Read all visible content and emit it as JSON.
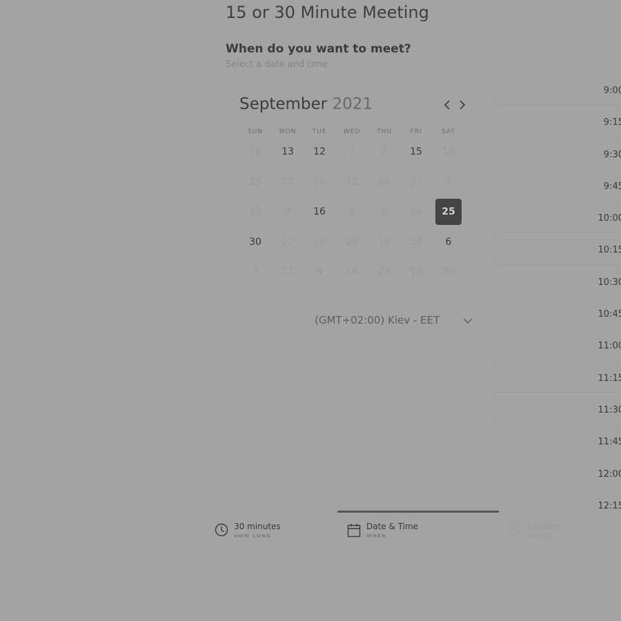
{
  "header": {
    "title": "15 or 30 Minute Meeting",
    "question": "When do you want to meet?",
    "subtitle": "Select a date and time"
  },
  "calendar": {
    "month": "September",
    "year": "2021",
    "weekdays": [
      "SUN",
      "MON",
      "TUE",
      "WED",
      "THU",
      "FRI",
      "SAT"
    ],
    "weeks": [
      [
        {
          "d": "28",
          "s": "disabled"
        },
        {
          "d": "13",
          "s": "available"
        },
        {
          "d": "12",
          "s": "available"
        },
        {
          "d": "7",
          "s": "disabled"
        },
        {
          "d": "2",
          "s": "disabled"
        },
        {
          "d": "15",
          "s": "available"
        },
        {
          "d": "13",
          "s": "disabled"
        }
      ],
      [
        {
          "d": "25",
          "s": "disabled"
        },
        {
          "d": "20",
          "s": "disabled"
        },
        {
          "d": "19",
          "s": "disabled"
        },
        {
          "d": "12",
          "s": "disabled"
        },
        {
          "d": "26",
          "s": "disabled"
        },
        {
          "d": "31",
          "s": "disabled"
        },
        {
          "d": "2",
          "s": "disabled"
        }
      ],
      [
        {
          "d": "12",
          "s": "disabled"
        },
        {
          "d": "9",
          "s": "disabled"
        },
        {
          "d": "16",
          "s": "available"
        },
        {
          "d": "8",
          "s": "disabled"
        },
        {
          "d": "6",
          "s": "disabled"
        },
        {
          "d": "26",
          "s": "disabled"
        },
        {
          "d": "25",
          "s": "selected"
        }
      ],
      [
        {
          "d": "30",
          "s": "available"
        },
        {
          "d": "17",
          "s": "disabled"
        },
        {
          "d": "10",
          "s": "disabled"
        },
        {
          "d": "29",
          "s": "disabled"
        },
        {
          "d": "18",
          "s": "disabled"
        },
        {
          "d": "30",
          "s": "disabled"
        },
        {
          "d": "6",
          "s": "available"
        }
      ],
      [
        {
          "d": "7",
          "s": "disabled"
        },
        {
          "d": "11",
          "s": "disabled"
        },
        {
          "d": "4",
          "s": "disabled"
        },
        {
          "d": "14",
          "s": "disabled"
        },
        {
          "d": "20",
          "s": "disabled"
        },
        {
          "d": "10",
          "s": "disabled"
        },
        {
          "d": "30",
          "s": "disabled"
        }
      ]
    ]
  },
  "timezone": {
    "label": "(GMT+02:00) Kiev - EET"
  },
  "time_slots": [
    "9:00",
    "9:15",
    "9:30",
    "9:45",
    "10:00",
    "10:15",
    "10:30",
    "10:45",
    "11:00",
    "11:15",
    "11:30",
    "11:45",
    "12:00",
    "12:15"
  ],
  "steps": [
    {
      "label": "30 minutes",
      "sub": "HOW LONG",
      "icon": "clock-icon"
    },
    {
      "label": "Date & Time",
      "sub": "WHEN",
      "icon": "calendar-icon"
    },
    {
      "label": "Location",
      "sub": "WHERE",
      "icon": "location-pin-icon"
    }
  ],
  "colors": {
    "background": "#a3a3a3",
    "selected_day": "#444444",
    "active_step_bar": "#555555"
  }
}
